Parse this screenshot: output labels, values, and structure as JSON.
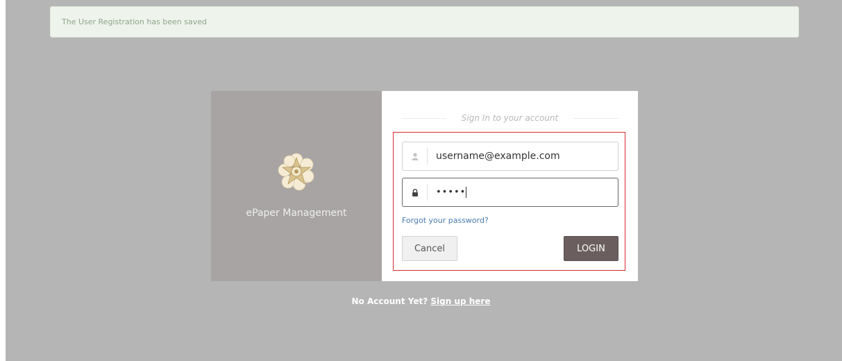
{
  "alert": {
    "message": "The User Registration has been saved"
  },
  "brand": {
    "app_name": "ePaper Management",
    "logo_icon": "emblem-icon"
  },
  "login": {
    "title": "Sign In to your account",
    "username": {
      "value": "username@example.com",
      "icon": "user-icon"
    },
    "password": {
      "masked_value": "•••••",
      "icon": "lock-icon"
    },
    "forgot_link": "Forgot your password?",
    "cancel_label": "Cancel",
    "login_label": "LOGIN"
  },
  "signup": {
    "prompt": "No Account Yet?",
    "link": "Sign up here"
  },
  "colors": {
    "backdrop": "#b5b5b5",
    "alert_bg": "#eef3ec",
    "left_panel": "#a8a4a4",
    "login_button": "#6b5e5e",
    "highlight_border": "#d62a2a",
    "link": "#4a7bb0"
  }
}
